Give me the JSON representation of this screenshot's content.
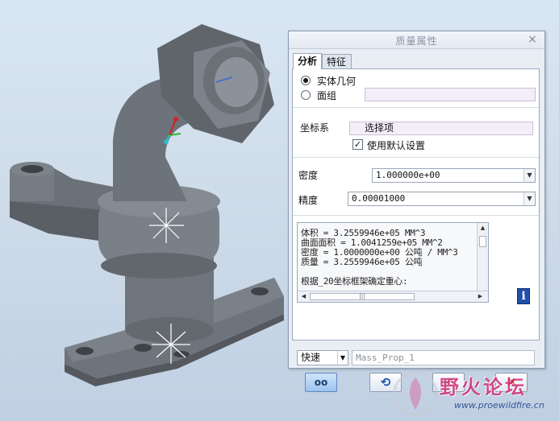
{
  "dialog": {
    "title": "质量属性",
    "close_symbol": "×",
    "tabs": [
      {
        "label": "分析",
        "active": true
      },
      {
        "label": "特征",
        "active": false
      }
    ],
    "geometry": {
      "options": [
        {
          "label": "实体几何",
          "selected": true
        },
        {
          "label": "面组",
          "selected": false
        }
      ],
      "quilt_value": ""
    },
    "csys": {
      "label": "坐标系",
      "field_text": "选择项",
      "use_default_label": "使用默认设置",
      "use_default_checked": true
    },
    "density": {
      "label": "密度",
      "value": "1.000000e+00"
    },
    "precision": {
      "label": "精度",
      "value": "0.00001000"
    },
    "results": {
      "lines": [
        "体积 =  3.2559946e+05  MM^3",
        "曲面面积 =  1.0041259e+05  MM^2",
        "密度 =  1.0000000e+00 公吨 / MM^3",
        "质量 =  3.2559946e+05 公吨",
        "根据_20坐标框架确定重心:"
      ]
    },
    "info_icon": "i",
    "mode": {
      "value": "快速"
    },
    "feature_name": {
      "value": "Mass_Prop_1"
    },
    "buttons": {
      "preview": "oo",
      "repeat": "⟲",
      "ok": "✔",
      "cancel": "✖"
    }
  },
  "watermark": {
    "title": "野火论坛",
    "url": "www.proewildfire.cn"
  },
  "colors": {
    "background_top": "#d9e6f3",
    "part_gray": "#6f757c",
    "ok_green": "#1e9a1e",
    "cancel_red": "#c41515",
    "watermark_pink": "#d1317a"
  }
}
